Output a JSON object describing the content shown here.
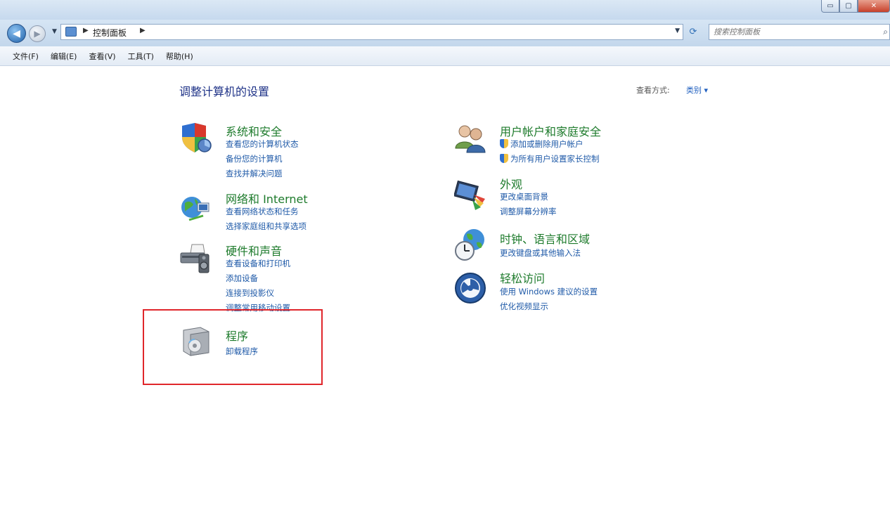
{
  "window": {
    "min_glyph": "▭",
    "max_glyph": "▢",
    "close_glyph": "✕"
  },
  "address": {
    "breadcrumb": [
      "控制面板"
    ],
    "search_placeholder": "搜索控制面板"
  },
  "menu": [
    "文件(F)",
    "编辑(E)",
    "查看(V)",
    "工具(T)",
    "帮助(H)"
  ],
  "main": {
    "title": "调整计算机的设置",
    "view_by_label": "查看方式:",
    "view_by_value": "类别 ▾"
  },
  "categories": {
    "system_security": {
      "title": "系统和安全",
      "links": [
        "查看您的计算机状态",
        "备份您的计算机",
        "查找并解决问题"
      ]
    },
    "network": {
      "title": "网络和 Internet",
      "links": [
        "查看网络状态和任务",
        "选择家庭组和共享选项"
      ]
    },
    "hardware": {
      "title": "硬件和声音",
      "links": [
        "查看设备和打印机",
        "添加设备",
        "连接到投影仪",
        "调整常用移动设置"
      ]
    },
    "programs": {
      "title": "程序",
      "links": [
        "卸载程序"
      ]
    },
    "user_accounts": {
      "title": "用户帐户和家庭安全",
      "links": [
        "添加或删除用户帐户",
        "为所有用户设置家长控制"
      ]
    },
    "appearance": {
      "title": "外观",
      "links": [
        "更改桌面背景",
        "调整屏幕分辨率"
      ]
    },
    "clock": {
      "title": "时钟、语言和区域",
      "links": [
        "更改键盘或其他输入法"
      ]
    },
    "ease": {
      "title": "轻松访问",
      "links": [
        "使用 Windows 建议的设置",
        "优化视频显示"
      ]
    }
  },
  "colors": {
    "title_green": "#1e7b2c",
    "link_blue": "#1f5aa8",
    "highlight_red": "#e0262b"
  }
}
